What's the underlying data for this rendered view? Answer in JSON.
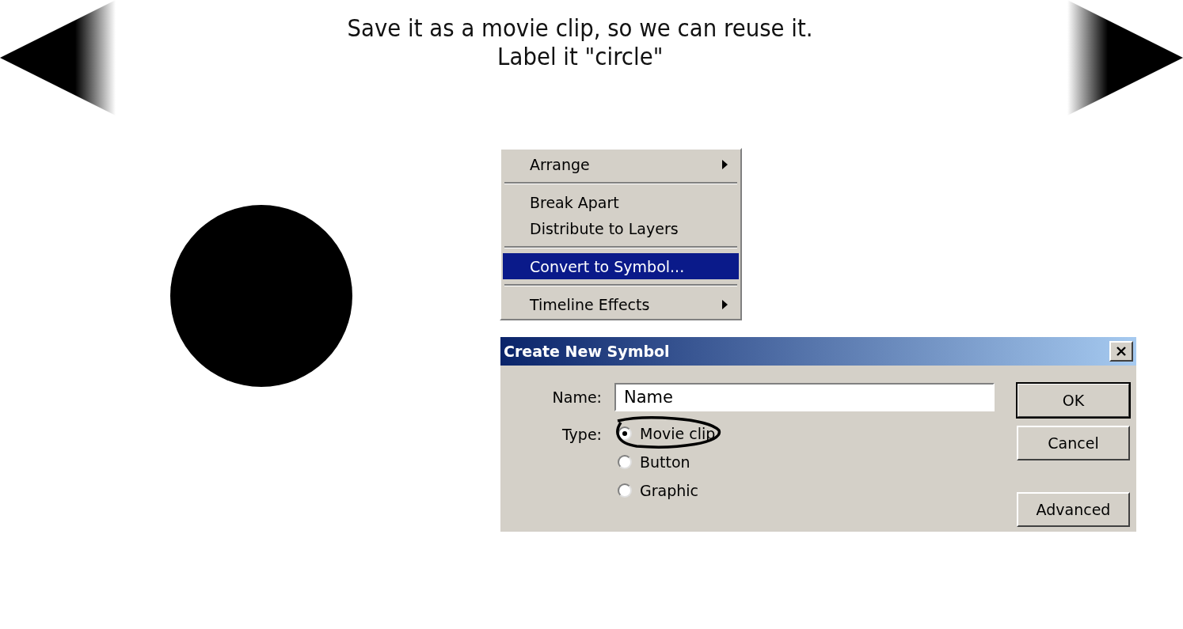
{
  "caption": [
    "Save it as a movie clip, so we can reuse it.",
    "Label it \"circle\""
  ],
  "context_menu": {
    "items": [
      {
        "kind": "item",
        "label": "Arrange",
        "submenu": true,
        "selected": false
      },
      {
        "kind": "separator"
      },
      {
        "kind": "item",
        "label": "Break Apart",
        "submenu": false,
        "selected": false
      },
      {
        "kind": "item",
        "label": "Distribute to Layers",
        "submenu": false,
        "selected": false
      },
      {
        "kind": "separator"
      },
      {
        "kind": "item",
        "label": "Convert to Symbol...",
        "submenu": false,
        "selected": true
      },
      {
        "kind": "separator"
      },
      {
        "kind": "item",
        "label": "Timeline Effects",
        "submenu": true,
        "selected": false
      }
    ]
  },
  "dialog": {
    "title": "Create New Symbol",
    "name_label": "Name:",
    "name_value": "Name",
    "type_label": "Type:",
    "types": [
      {
        "label": "Movie clip",
        "selected": true,
        "circled": true
      },
      {
        "label": "Button",
        "selected": false,
        "circled": false
      },
      {
        "label": "Graphic",
        "selected": false,
        "circled": false
      }
    ],
    "buttons": [
      {
        "label": "OK",
        "default": true
      },
      {
        "label": "Cancel",
        "default": false
      },
      {
        "label": "Advanced",
        "default": false
      }
    ]
  }
}
